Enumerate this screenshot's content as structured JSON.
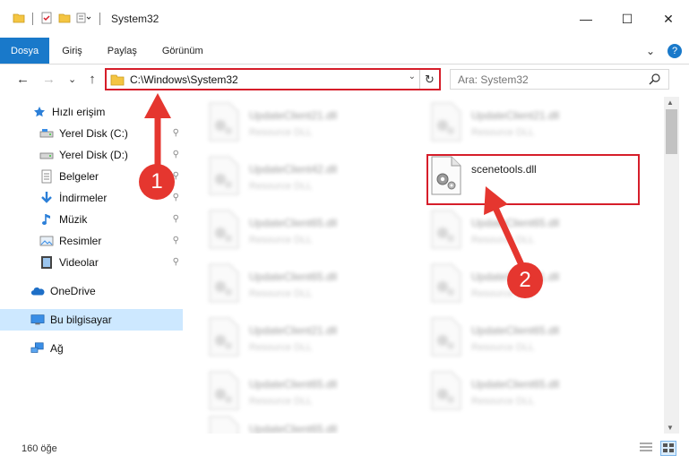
{
  "window": {
    "title": "System32",
    "controls": {
      "minimize": "—",
      "maximize": "☐",
      "close": "✕"
    }
  },
  "ribbon": {
    "tabs": [
      "Dosya",
      "Giriş",
      "Paylaş",
      "Görünüm"
    ],
    "active_tab": "Dosya",
    "expand_glyph": "⌄",
    "help_glyph": "?"
  },
  "address_bar": {
    "path": "C:\\Windows\\System32",
    "dropdown_glyph": "⌄",
    "refresh_glyph": "↻"
  },
  "nav_buttons": {
    "back": "←",
    "forward": "→",
    "recent": "⌄",
    "up": "↑"
  },
  "search": {
    "placeholder": "Ara: System32"
  },
  "sidebar": {
    "items": [
      {
        "label": "Hızlı erişim",
        "icon": "star-icon",
        "pinned": false
      },
      {
        "label": "Yerel Disk (C:)",
        "icon": "drive-icon",
        "pinned": true
      },
      {
        "label": "Yerel Disk (D:)",
        "icon": "drive-icon",
        "pinned": true
      },
      {
        "label": "Belgeler",
        "icon": "documents-icon",
        "pinned": true
      },
      {
        "label": "İndirmeler",
        "icon": "download-icon",
        "pinned": true
      },
      {
        "label": "Müzik",
        "icon": "music-icon",
        "pinned": true
      },
      {
        "label": "Resimler",
        "icon": "pictures-icon",
        "pinned": true
      },
      {
        "label": "Videolar",
        "icon": "videos-icon",
        "pinned": true
      },
      {
        "label": "OneDrive",
        "icon": "cloud-icon",
        "pinned": false
      },
      {
        "label": "Bu bilgisayar",
        "icon": "computer-icon",
        "pinned": false,
        "selected": true
      },
      {
        "label": "Ağ",
        "icon": "network-icon",
        "pinned": false
      }
    ],
    "pin_glyph": "📌"
  },
  "files": {
    "highlighted": {
      "name": "scenetools.dll"
    },
    "blurred": [
      {
        "name": "UpdateClient21.dll",
        "type": "Resource DLL"
      },
      {
        "name": "UpdateClient21.dll",
        "type": "Resource DLL"
      },
      {
        "name": "UpdateClient42.dll",
        "type": "Resource DLL"
      },
      {
        "name": "UpdateClient65.dll",
        "type": "Resource DLL"
      },
      {
        "name": "UpdateClient65.dll",
        "type": "Resource DLL"
      },
      {
        "name": "UpdateClient65.dll",
        "type": "Resource DLL"
      },
      {
        "name": "UpdateClient21.dll",
        "type": "Resource DLL"
      },
      {
        "name": "UpdateClient21.dll",
        "type": "Resource DLL"
      },
      {
        "name": "UpdateClient65.dll",
        "type": "Resource DLL"
      },
      {
        "name": "UpdateClient65.dll",
        "type": "Resource DLL"
      },
      {
        "name": "UpdateClient65.dll",
        "type": "Resource DLL"
      },
      {
        "name": "UpdateClient65.dll",
        "type": "Resource DLL"
      }
    ]
  },
  "status_bar": {
    "item_count": "160 öğe"
  },
  "annotations": {
    "step1": "1",
    "step2": "2",
    "color": "#e5362f"
  }
}
